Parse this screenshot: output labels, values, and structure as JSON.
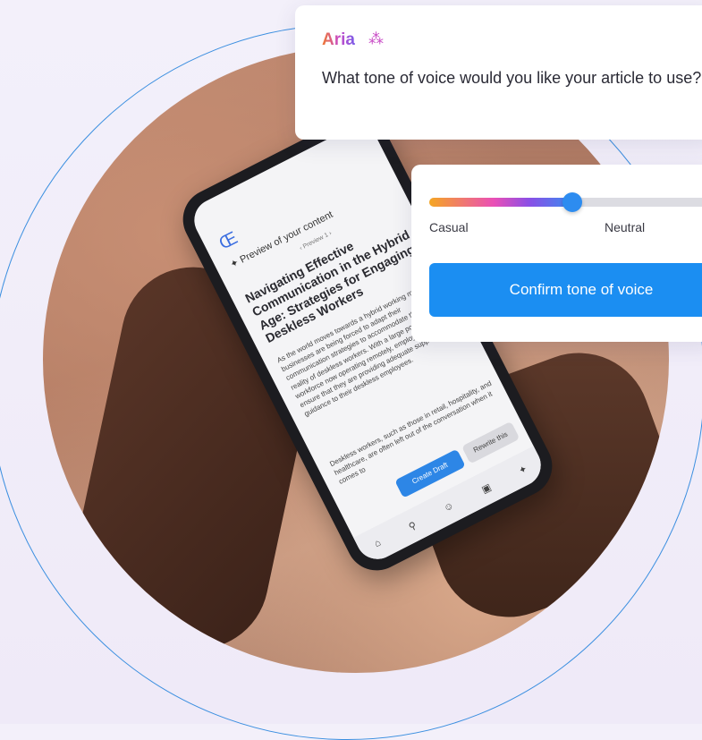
{
  "aria": {
    "name": "Aria",
    "question": "What tone of voice would you like your article to use?"
  },
  "tone": {
    "value_percent": 50,
    "labels": [
      "Casual",
      "Neutral"
    ],
    "confirm_label": "Confirm tone of voice"
  },
  "phone": {
    "logo": "Œ",
    "preview_title": "Preview of your content",
    "preview_nav": "‹  Preview 1  ›",
    "article_title": "Navigating Effective Communication in the Hybrid Age: Strategies for Engaging Deskless Workers",
    "paragraph1": "As the world moves towards a hybrid working model, businesses are being forced to adapt their communication strategies to accommodate the new reality of deskless workers. With a large portion of the workforce now operating remotely, employers must ensure that they are providing adequate support and guidance to their deskless employees.",
    "paragraph2": "Deskless workers, such as those in retail, hospitality, and healthcare, are often left out of the conversation when it comes to",
    "create_draft": "Create Draft",
    "rewrite": "Rewrite this"
  },
  "colors": {
    "ring": "#3b8fe0",
    "confirm_button": "#1b8ef2",
    "slider_knob": "#2d8cf0"
  }
}
